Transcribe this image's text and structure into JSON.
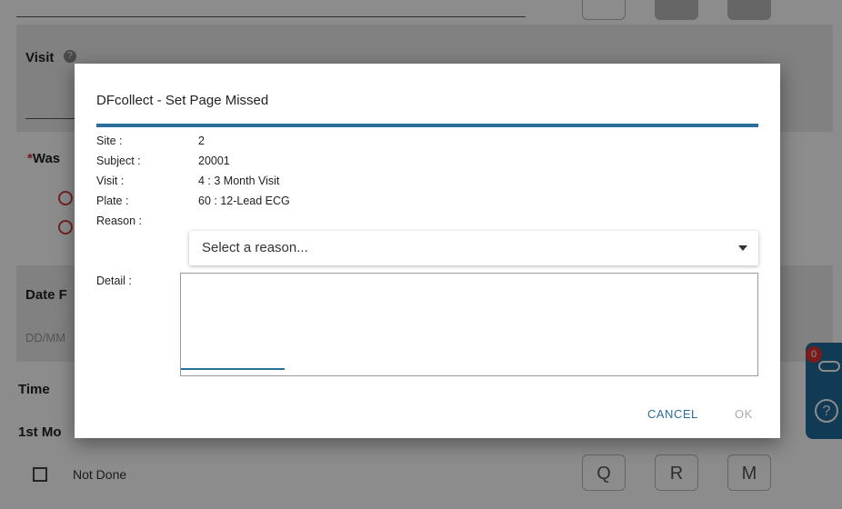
{
  "background": {
    "visit_label": "Visit",
    "was_label_prefix": "*",
    "was_label": "Was",
    "date_label": "Date F",
    "date_placeholder": "DD/MM",
    "time_label": "Time",
    "first_measurement_label": "1st Mo",
    "not_done_label": "Not Done",
    "code_buttons": [
      "Q",
      "R",
      "M"
    ],
    "notes_badge_count": "0"
  },
  "dialog": {
    "title": "DFcollect - Set Page Missed",
    "fields": [
      {
        "label": "Site :",
        "value": "2"
      },
      {
        "label": "Subject :",
        "value": "20001"
      },
      {
        "label": "Visit :",
        "value": "4 : 3 Month Visit"
      },
      {
        "label": "Plate :",
        "value": "60 : 12-Lead ECG"
      }
    ],
    "reason_label": "Reason :",
    "reason_placeholder": "Select a reason...",
    "detail_label": "Detail :",
    "detail_value": "",
    "cancel_label": "CANCEL",
    "ok_label": "OK"
  },
  "colors": {
    "accent": "#2a6f9a",
    "side_widget": "#1f6b9a",
    "badge": "#dd3333"
  }
}
